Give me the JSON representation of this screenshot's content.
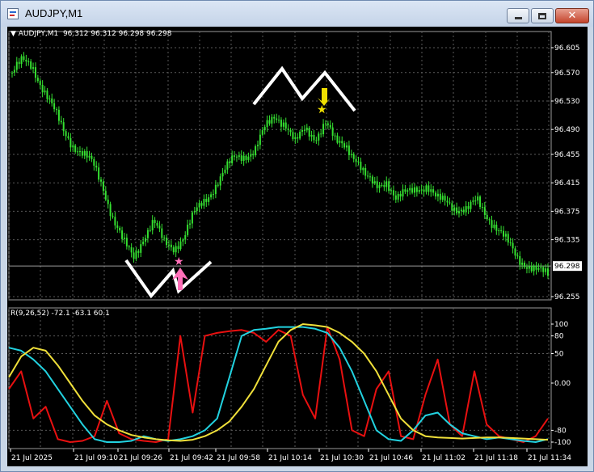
{
  "window": {
    "title": "AUDJPY,M1",
    "minimize_label": "",
    "maximize_label": "",
    "close_label": "✕"
  },
  "price_header": {
    "arrow": "▼",
    "symbol": "AUDJPY,M1",
    "ohlc": "96.312 96.312 96.298 96.298"
  },
  "indicator_header": {
    "text": "R(9,26,52) -72.1 -63.1 60.1"
  },
  "colors": {
    "background": "#000000",
    "grid": "#5a5a5a",
    "candle": "#35e031",
    "bid_line": "#9a9a9a",
    "red_line": "#e81010",
    "cyan_line": "#22d2e0",
    "yellow_line": "#f0e03a",
    "buy_arrow": "#ff6fb8",
    "sell_arrow": "#f0e000",
    "pattern": "#ffffff"
  },
  "icons": {
    "sell_marker": "star-down-arrow-icon",
    "buy_marker": "star-up-arrow-icon"
  },
  "chart_data": [
    {
      "type": "candlestick",
      "symbol": "AUDJPY",
      "timeframe": "M1",
      "y_ticks": [
        "96.605",
        "96.570",
        "96.530",
        "96.490",
        "96.455",
        "96.415",
        "96.375",
        "96.335",
        "96.298",
        "96.255"
      ],
      "ylim": [
        96.255,
        96.605
      ],
      "current_price": "96.298",
      "close_path": [
        96.57,
        96.585,
        96.58,
        96.55,
        96.52,
        96.49,
        96.47,
        96.455,
        96.44,
        96.41,
        96.365,
        96.33,
        96.31,
        96.34,
        96.36,
        96.33,
        96.325,
        96.34,
        96.37,
        96.39,
        96.41,
        96.43,
        96.45,
        96.455,
        96.46,
        96.49,
        96.51,
        96.5,
        96.47,
        96.49,
        96.48,
        96.5,
        96.47,
        96.47,
        96.45,
        96.42,
        96.41,
        96.42,
        96.39,
        96.4,
        96.41,
        96.41,
        96.39,
        96.39,
        96.38,
        96.375,
        96.39,
        96.37,
        96.35,
        96.33,
        96.31,
        96.3,
        96.29,
        96.285
      ]
    },
    {
      "type": "line",
      "name": "R(9,26,52)",
      "y_ticks": [
        "100",
        "80",
        "50",
        "0.00",
        "-80",
        "-100"
      ],
      "ylim": [
        -100,
        100
      ],
      "x_ticks": [
        "21 Jul 2025",
        "21 Jul 09:10",
        "21 Jul 09:26",
        "21 Jul 09:42",
        "21 Jul 09:58",
        "21 Jul 10:14",
        "21 Jul 10:30",
        "21 Jul 10:46",
        "21 Jul 11:02",
        "21 Jul 11:18",
        "21 Jul 11:34"
      ],
      "last_values": [
        -72.1,
        -63.1,
        60.1
      ],
      "series": [
        {
          "values": [
            -10,
            20,
            -60,
            -40,
            -95,
            -100,
            -98,
            -90,
            -30,
            -85,
            -95,
            -98,
            -100,
            -95,
            80,
            -50,
            80,
            85,
            88,
            90,
            85,
            70,
            90,
            80,
            -20,
            -60,
            95,
            40,
            -80,
            -90,
            -10,
            20,
            -90,
            -95,
            -20,
            40,
            -70,
            -90,
            20,
            -70,
            -90,
            -95,
            -100,
            -90,
            -60
          ]
        },
        {
          "values": [
            60,
            55,
            40,
            20,
            -10,
            -40,
            -70,
            -95,
            -100,
            -100,
            -98,
            -90,
            -95,
            -98,
            -95,
            -90,
            -80,
            -60,
            10,
            80,
            90,
            92,
            95,
            95,
            95,
            92,
            85,
            60,
            20,
            -30,
            -80,
            -95,
            -98,
            -80,
            -55,
            -50,
            -70,
            -85,
            -90,
            -95,
            -92,
            -95,
            -98,
            -100,
            -95
          ]
        },
        {
          "values": [
            10,
            45,
            60,
            55,
            30,
            0,
            -30,
            -55,
            -70,
            -80,
            -88,
            -92,
            -95,
            -97,
            -98,
            -96,
            -90,
            -80,
            -65,
            -40,
            -10,
            30,
            70,
            90,
            100,
            98,
            95,
            85,
            70,
            50,
            20,
            -20,
            -60,
            -80,
            -90,
            -92,
            -93,
            -94,
            -93,
            -92,
            -92,
            -93,
            -94,
            -95,
            -96
          ]
        }
      ]
    }
  ]
}
